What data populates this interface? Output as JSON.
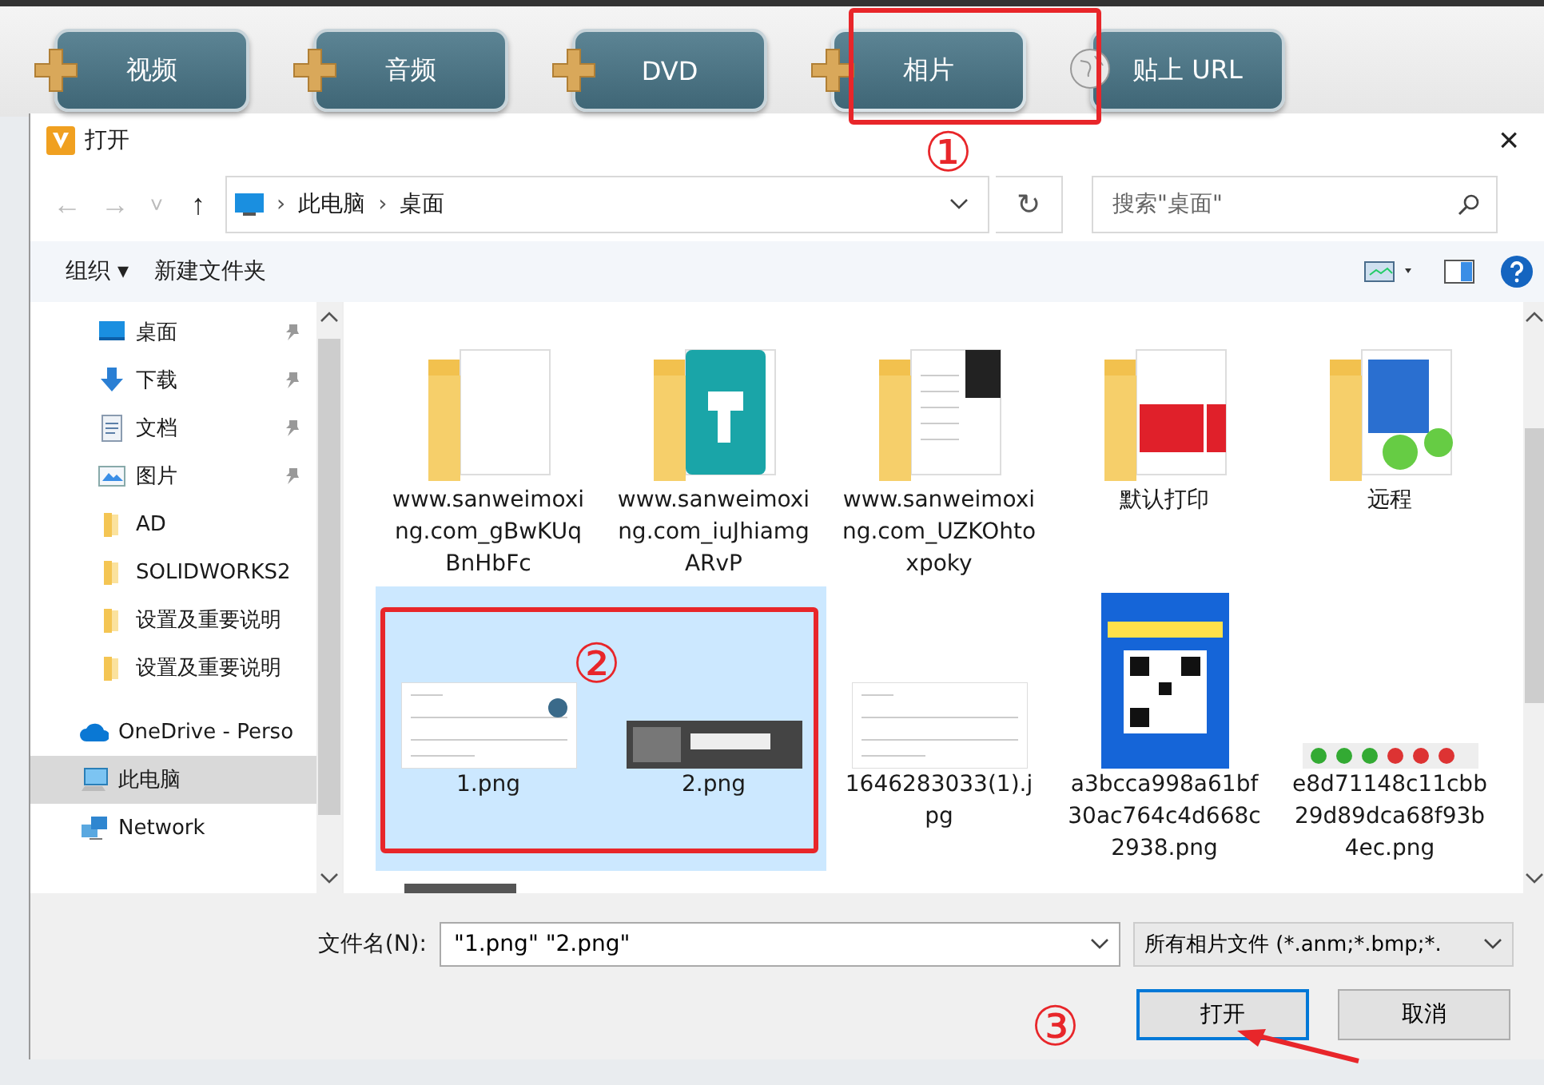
{
  "app_toolbar": {
    "buttons": [
      {
        "label": "视频",
        "kind": "add",
        "selected": false
      },
      {
        "label": "音频",
        "kind": "add",
        "selected": false
      },
      {
        "label": "DVD",
        "kind": "add",
        "selected": false
      },
      {
        "label": "相片",
        "kind": "add",
        "selected": true
      },
      {
        "label": "贴上 URL",
        "kind": "web",
        "selected": false
      }
    ]
  },
  "window": {
    "title": "打开",
    "close": "×"
  },
  "nav": {
    "back": "←",
    "forward": "→",
    "recent": "˅",
    "up": "↑",
    "breadcrumb": [
      {
        "separator": "›",
        "label": "此电脑"
      },
      {
        "separator": "›",
        "label": "桌面"
      }
    ],
    "refresh": "↻",
    "search": {
      "placeholder": "搜索\"桌面\""
    }
  },
  "toolbar": {
    "organize": "组织",
    "organize_caret": "▾",
    "new_folder": "新建文件夹"
  },
  "sidebar": {
    "items": [
      {
        "label": "桌面",
        "kind": "desktop",
        "pinned": true,
        "selected": false
      },
      {
        "label": "下载",
        "kind": "download",
        "pinned": true,
        "selected": false
      },
      {
        "label": "文档",
        "kind": "document",
        "pinned": true,
        "selected": false
      },
      {
        "label": "图片",
        "kind": "picture",
        "pinned": true,
        "selected": false
      },
      {
        "label": "AD",
        "kind": "folder",
        "pinned": false,
        "selected": false
      },
      {
        "label": "SOLIDWORKS2",
        "kind": "folder",
        "pinned": false,
        "selected": false
      },
      {
        "label": "设置及重要说明",
        "kind": "folder",
        "pinned": false,
        "selected": false
      },
      {
        "label": "设置及重要说明",
        "kind": "folder",
        "pinned": false,
        "selected": false
      },
      {
        "label": "OneDrive - Perso",
        "kind": "cloud",
        "pinned": false,
        "selected": false
      },
      {
        "label": "此电脑",
        "kind": "computer",
        "pinned": false,
        "selected": true
      },
      {
        "label": "Network",
        "kind": "network",
        "pinned": false,
        "selected": false
      }
    ]
  },
  "files": [
    {
      "name": "www.sanweimoxing.com_gBwKUqBnHbFc",
      "kind": "folder",
      "selected": false
    },
    {
      "name": "www.sanweimoxing.com_iuJhiamgARvP",
      "kind": "folder",
      "selected": false
    },
    {
      "name": "www.sanweimoxing.com_UZKOhtoxpoky",
      "kind": "folder",
      "selected": false
    },
    {
      "name": "默认打印",
      "kind": "folder",
      "selected": false
    },
    {
      "name": "远程",
      "kind": "folder",
      "selected": false
    },
    {
      "name": "1.png",
      "kind": "image",
      "selected": true
    },
    {
      "name": "2.png",
      "kind": "image",
      "selected": true
    },
    {
      "name": "1646283033(1).jpg",
      "kind": "image",
      "selected": false
    },
    {
      "name": "a3bcca998a61bf30ac764c4d668c2938.png",
      "kind": "poster",
      "selected": false
    },
    {
      "name": "e8d71148c11cbb29d89dca68f93b4ec.png",
      "kind": "strip",
      "selected": false
    }
  ],
  "footer": {
    "filename_label": "文件名(N):",
    "filename": "\"1.png\" \"2.png\"",
    "filter": "所有相片文件 (*.anm;*.bmp;*.",
    "open": "打开",
    "cancel": "取消"
  },
  "annotations": [
    {
      "label": "①"
    },
    {
      "label": "②"
    },
    {
      "label": "③"
    }
  ]
}
